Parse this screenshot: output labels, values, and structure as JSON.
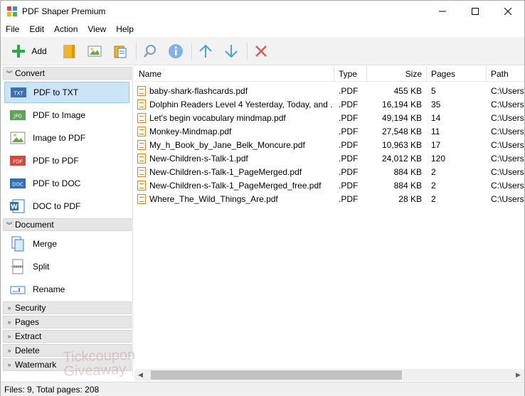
{
  "window": {
    "title": "PDF Shaper Premium"
  },
  "menu": [
    "File",
    "Edit",
    "Action",
    "View",
    "Help"
  ],
  "toolbar": {
    "add_label": "Add",
    "accent": "#2aa84a",
    "arrow_color": "#4aa3e0",
    "delete_color": "#e05a5a"
  },
  "sidebar": {
    "groups": {
      "convert": "Convert",
      "document": "Document",
      "security": "Security",
      "pages": "Pages",
      "extract": "Extract",
      "delete": "Delete",
      "watermark": "Watermark"
    },
    "convert_items": [
      {
        "label": "PDF to TXT",
        "icon": "txt-icon",
        "badge": "TXT"
      },
      {
        "label": "PDF to Image",
        "icon": "jpg-icon",
        "badge": "JPG"
      },
      {
        "label": "Image to PDF",
        "icon": "image-icon",
        "badge": ""
      },
      {
        "label": "PDF to PDF",
        "icon": "pdf-icon",
        "badge": "PDF"
      },
      {
        "label": "PDF to DOC",
        "icon": "doc-icon",
        "badge": "DOC"
      },
      {
        "label": "DOC to PDF",
        "icon": "word-icon",
        "badge": "W"
      }
    ],
    "document_items": [
      {
        "label": "Merge",
        "icon": "merge-icon"
      },
      {
        "label": "Split",
        "icon": "split-icon"
      },
      {
        "label": "Rename",
        "icon": "rename-icon"
      }
    ]
  },
  "table": {
    "columns": [
      "Name",
      "Type",
      "Size",
      "Pages",
      "Path"
    ],
    "rows": [
      {
        "name": "baby-shark-flashcards.pdf",
        "type": ".PDF",
        "size": "455 KB",
        "pages": "5",
        "path": "C:\\Users\\"
      },
      {
        "name": "Dolphin Readers Level 4 Yesterday, Today, and ...",
        "type": ".PDF",
        "size": "16,194 KB",
        "pages": "35",
        "path": "C:\\Users\\"
      },
      {
        "name": "Let's begin vocabulary mindmap.pdf",
        "type": ".PDF",
        "size": "49,194 KB",
        "pages": "14",
        "path": "C:\\Users\\"
      },
      {
        "name": "Monkey-Mindmap.pdf",
        "type": ".PDF",
        "size": "27,548 KB",
        "pages": "11",
        "path": "C:\\Users\\"
      },
      {
        "name": "My_h_Book_by_Jane_Belk_Moncure.pdf",
        "type": ".PDF",
        "size": "10,963 KB",
        "pages": "17",
        "path": "C:\\Users\\"
      },
      {
        "name": "New-Children-s-Talk-1.pdf",
        "type": ".PDF",
        "size": "24,012 KB",
        "pages": "120",
        "path": "C:\\Users\\"
      },
      {
        "name": "New-Children-s-Talk-1_PageMerged.pdf",
        "type": ".PDF",
        "size": "884 KB",
        "pages": "2",
        "path": "C:\\Users\\"
      },
      {
        "name": "New-Children-s-Talk-1_PageMerged_free.pdf",
        "type": ".PDF",
        "size": "884 KB",
        "pages": "2",
        "path": "C:\\Users\\"
      },
      {
        "name": "Where_The_Wild_Things_Are.pdf",
        "type": ".PDF",
        "size": "28 KB",
        "pages": "2",
        "path": "C:\\Users\\"
      }
    ]
  },
  "status": "Files: 9, Total pages: 208",
  "watermark": {
    "line1": "Tickcoupon",
    "line2": "Giveaway"
  }
}
